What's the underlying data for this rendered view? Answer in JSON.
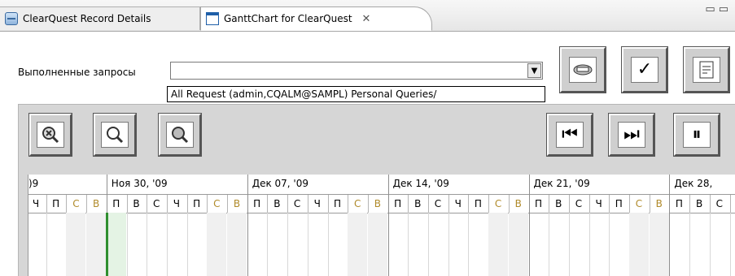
{
  "tabs": [
    {
      "label": "ClearQuest Record Details",
      "icon": "record-details-icon",
      "active": false
    },
    {
      "label": "GanttChart for ClearQuest",
      "icon": "gantt-chart-icon",
      "active": true,
      "close": "✕"
    }
  ],
  "window_controls": {
    "minimize": "▭",
    "maximize": "▭"
  },
  "queries": {
    "label": "Выполненные запросы",
    "value": "",
    "dropdown_arrow": "▼",
    "selected_path": "All Request (admin,CQALM@SAMPL) Personal Queries/"
  },
  "toolbar_top": {
    "run_query_icon": "run-query-icon",
    "confirm_glyph": "✓",
    "report_icon": "report-icon"
  },
  "toolbar_nav": {
    "zoom_reset_icon": "zoom-reset-icon",
    "zoom_out_icon": "zoom-out-icon",
    "zoom_in_icon": "zoom-in-icon",
    "first_glyph": "⏮",
    "last_glyph": "⏭",
    "pause_glyph": "⏸"
  },
  "gantt": {
    "weeks": [
      ")9",
      "Ноя 30, '09",
      "Дек 07, '09",
      "Дек 14, '09",
      "Дек 21, '09",
      "Дек 28,"
    ],
    "days": [
      "Ч",
      "П",
      "С",
      "В",
      "П",
      "В",
      "С",
      "Ч",
      "П",
      "С",
      "В",
      "П",
      "В",
      "С",
      "Ч",
      "П",
      "С",
      "В",
      "П",
      "В",
      "С",
      "Ч",
      "П",
      "С",
      "В",
      "П",
      "В",
      "С",
      "Ч",
      "П",
      "С",
      "В",
      "П",
      "В",
      "С"
    ],
    "colors": {
      "weekend_text": "#b08a2a",
      "today_line": "#2f8f2f",
      "today_band": "#e4f3e4"
    }
  }
}
